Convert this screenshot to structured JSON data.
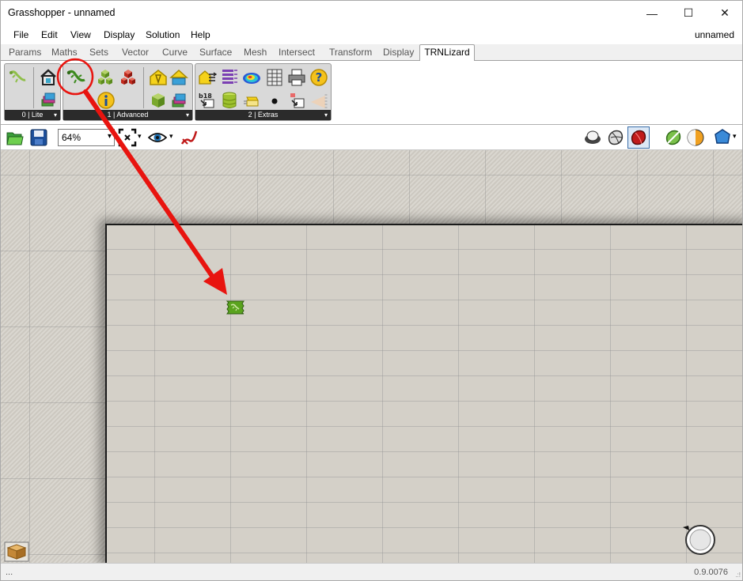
{
  "window": {
    "title": "Grasshopper - unnamed"
  },
  "window_controls": {
    "minimize": "—",
    "maximize": "☐",
    "close": "✕"
  },
  "menu": {
    "items": [
      "File",
      "Edit",
      "View",
      "Display",
      "Solution",
      "Help"
    ],
    "document": "unnamed"
  },
  "tabs": {
    "items": [
      "Params",
      "Maths",
      "Sets",
      "Vector",
      "Curve",
      "Surface",
      "Mesh",
      "Intersect",
      "Transform",
      "Display"
    ],
    "active": "TRNLizard"
  },
  "ribbon": {
    "groups": [
      {
        "label": "0 | Lite"
      },
      {
        "label": "1 | Advanced"
      },
      {
        "label": "2 | Extras"
      }
    ],
    "group_arrow": "▾",
    "icons": {
      "b18_label": "b18"
    }
  },
  "toolbar": {
    "zoom": "64%",
    "zoom_arrow": "▾",
    "dropdown_arrow": "▾"
  },
  "canvas": {
    "component_icon": "lizard-component-icon"
  },
  "status": {
    "left": "...",
    "version": "0.9.0076",
    "grip": ".:!"
  },
  "annotation": {
    "color": "#e8140f"
  },
  "colors": {
    "accent_green": "#5aa31e",
    "canvas": "#d4d0c8",
    "ribbon_label": "#2b2b2b"
  }
}
